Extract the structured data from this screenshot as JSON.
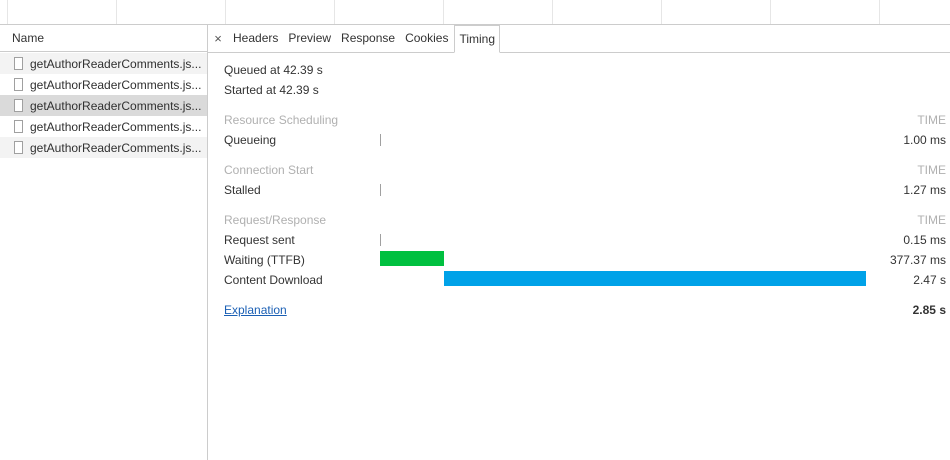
{
  "request_list": {
    "header": "Name",
    "items": [
      {
        "name": "getAuthorReaderComments.js...",
        "state": "striped"
      },
      {
        "name": "getAuthorReaderComments.js...",
        "state": "normal"
      },
      {
        "name": "getAuthorReaderComments.js...",
        "state": "selected"
      },
      {
        "name": "getAuthorReaderComments.js...",
        "state": "normal"
      },
      {
        "name": "getAuthorReaderComments.js...",
        "state": "striped"
      }
    ]
  },
  "tabs": {
    "close_glyph": "×",
    "items": [
      "Headers",
      "Preview",
      "Response",
      "Cookies",
      "Timing"
    ],
    "active": "Timing"
  },
  "timing": {
    "queued_at": "Queued at 42.39 s",
    "started_at": "Started at 42.39 s",
    "time_header": "TIME",
    "sections": [
      {
        "title": "Resource Scheduling",
        "rows": [
          {
            "label": "Queueing",
            "value": "1.00 ms"
          }
        ]
      },
      {
        "title": "Connection Start",
        "rows": [
          {
            "label": "Stalled",
            "value": "1.27 ms"
          }
        ]
      },
      {
        "title": "Request/Response",
        "rows": [
          {
            "label": "Request sent",
            "value": "0.15 ms"
          },
          {
            "label": "Waiting (TTFB)",
            "value": "377.37 ms"
          },
          {
            "label": "Content Download",
            "value": "2.47 s"
          }
        ]
      }
    ],
    "explanation": "Explanation",
    "total": "2.85 s",
    "bar_colors": {
      "waiting": "#00c040",
      "download": "#00a2e8"
    },
    "bar_fractions": {
      "waiting": {
        "start": 0.0,
        "end": 0.132
      },
      "download": {
        "start": 0.132,
        "end": 1.0
      }
    }
  }
}
